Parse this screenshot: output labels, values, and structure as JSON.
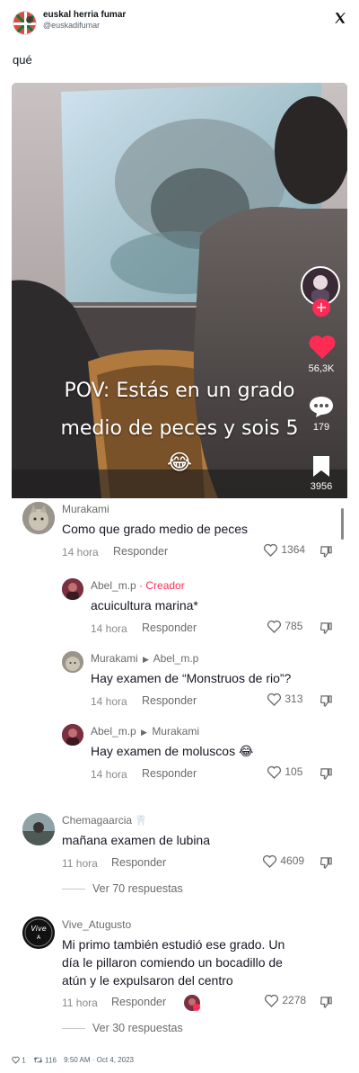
{
  "tweet": {
    "display_name": "euskal herria fumar",
    "handle": "@euskadifumar",
    "text": "qué",
    "footer": {
      "likes": "1",
      "retweets": "116",
      "timestamp": "9:50 AM · Oct 4, 2023"
    }
  },
  "video": {
    "caption_line1": "POV: Estás en un grado",
    "caption_line2": "medio de peces y sois 5",
    "caption_emoji": "😂",
    "likes": "56,3K",
    "comments": "179",
    "bookmarks": "3956",
    "icons": [
      "creator-avatar",
      "follow-plus-icon",
      "heart-icon",
      "comment-bubble-icon",
      "bookmark-icon"
    ]
  },
  "comments": [
    {
      "user": "Murakami",
      "text": "Como que grado medio de peces",
      "time": "14 hora",
      "reply_label": "Responder",
      "likes": "1364"
    },
    {
      "user": "Abel_m.p",
      "tag": "· Creador",
      "text": "acuicultura marina*",
      "time": "14 hora",
      "reply_label": "Responder",
      "likes": "785"
    },
    {
      "user": "Murakami",
      "reply_to": "Abel_m.p",
      "text": "Hay examen de “Monstruos de rio”?",
      "time": "14 hora",
      "reply_label": "Responder",
      "likes": "313"
    },
    {
      "user": "Abel_m.p",
      "reply_to": "Murakami",
      "text": "Hay examen de moluscos 😂",
      "time": "14 hora",
      "reply_label": "Responder",
      "likes": "105"
    },
    {
      "user": "Chemagaarcia",
      "text": "mañana examen de lubina",
      "time": "11 hora",
      "reply_label": "Responder",
      "likes": "4609",
      "view_replies": "Ver 70 respuestas"
    },
    {
      "user": "Vive_Atugusto",
      "text_lines": [
        "Mi primo también estudió ese grado. Un",
        "día le pillaron comiendo un bocadillo de",
        "atún y le expulsaron del centro"
      ],
      "time": "11 hora",
      "reply_label": "Responder",
      "likes": "2278",
      "view_replies": "Ver 30 respuestas"
    }
  ],
  "colors": {
    "tiktok_red": "#fe2c55",
    "text_dark": "#161823",
    "text_gray": "#8a8a8a",
    "twitter_gray": "#536471"
  }
}
